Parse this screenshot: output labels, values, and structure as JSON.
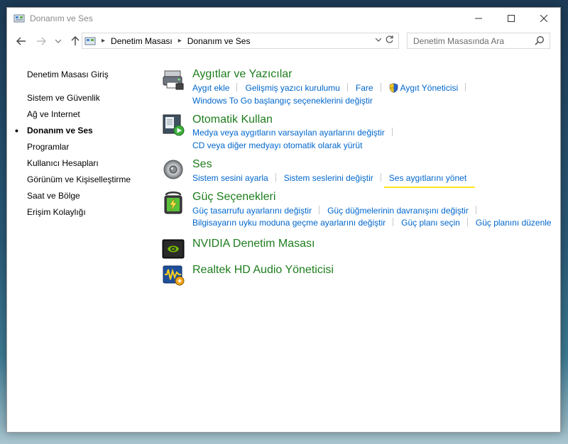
{
  "window": {
    "title": "Donanım ve Ses"
  },
  "address": {
    "breadcrumbs": [
      "Denetim Masası",
      "Donanım ve Ses"
    ]
  },
  "search": {
    "placeholder": "Denetim Masasında Ara"
  },
  "sidebar": {
    "home": "Denetim Masası Giriş",
    "items": [
      {
        "label": "Sistem ve Güvenlik"
      },
      {
        "label": "Ağ ve Internet"
      },
      {
        "label": "Donanım ve Ses"
      },
      {
        "label": "Programlar"
      },
      {
        "label": "Kullanıcı Hesapları"
      },
      {
        "label": "Görünüm ve Kişiselleştirme"
      },
      {
        "label": "Saat ve Bölge"
      },
      {
        "label": "Erişim Kolaylığı"
      }
    ]
  },
  "categories": {
    "devices": {
      "title": "Aygıtlar ve Yazıcılar",
      "links": [
        "Aygıt ekle",
        "Gelişmiş yazıcı kurulumu",
        "Fare",
        "Aygıt Yöneticisi",
        "Windows To Go başlangıç seçeneklerini değiştir"
      ],
      "icon": "devices-printers-icon"
    },
    "autoplay": {
      "title": "Otomatik Kullan",
      "links": [
        "Medya veya aygıtların varsayılan ayarlarını değiştir",
        "CD veya diğer medyayı otomatik olarak yürüt"
      ],
      "icon": "autoplay-icon"
    },
    "sound": {
      "title": "Ses",
      "links": [
        "Sistem sesini ayarla",
        "Sistem seslerini değiştir",
        "Ses aygıtlarını yönet"
      ],
      "icon": "speaker-icon"
    },
    "power": {
      "title": "Güç Seçenekleri",
      "links": [
        "Güç tasarrufu ayarlarını değiştir",
        "Güç düğmelerinin davranışını değiştir",
        "Bilgisayarın uyku moduna geçme ayarlarını değiştir",
        "Güç planı seçin",
        "Güç planını düzenle"
      ],
      "icon": "battery-icon"
    },
    "nvidia": {
      "title": "NVIDIA Denetim Masası",
      "icon": "nvidia-icon"
    },
    "realtek": {
      "title": "Realtek HD Audio Yöneticisi",
      "icon": "realtek-audio-icon"
    }
  },
  "colors": {
    "category_title": "#1e7d1e",
    "link": "#0066cc",
    "highlight": "#ffe51a"
  }
}
